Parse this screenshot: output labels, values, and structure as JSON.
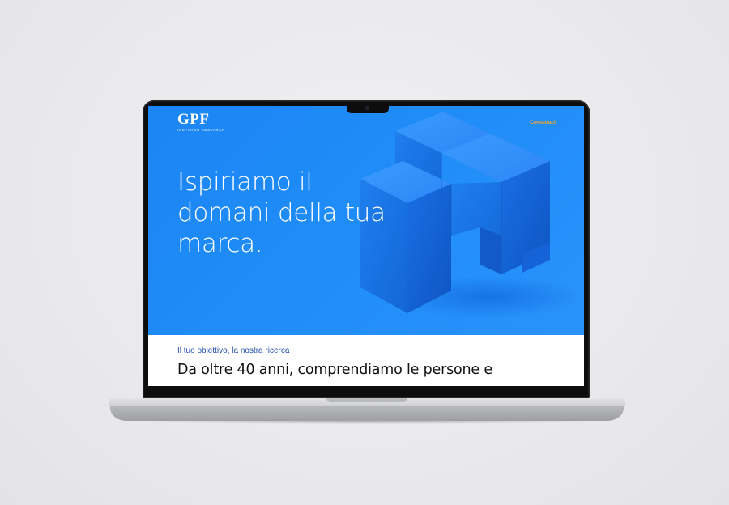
{
  "site": {
    "logo_mark": "GPF",
    "logo_tagline": "INSPIRING RESEARCH",
    "nav": {
      "contact_label": "Contattaci"
    },
    "hero": {
      "headline_line1": "Ispiriamo il",
      "headline_line2": "domani della tua",
      "headline_line3": "marca."
    },
    "intro": {
      "eyebrow": "Il tuo obiettivo, la nostra ricerca",
      "heading": "Da oltre 40 anni, comprendiamo le persone e"
    }
  },
  "colors": {
    "hero_blue": "#1f8cf7",
    "accent_orange": "#f5a623",
    "eyebrow_blue": "#1f4fa8",
    "laptop_bezel": "#0d0d0e",
    "laptop_silver": "#cfd0d2"
  },
  "icons": {
    "hero_visual": "blue-cube-icon",
    "camera": "webcam-icon"
  }
}
